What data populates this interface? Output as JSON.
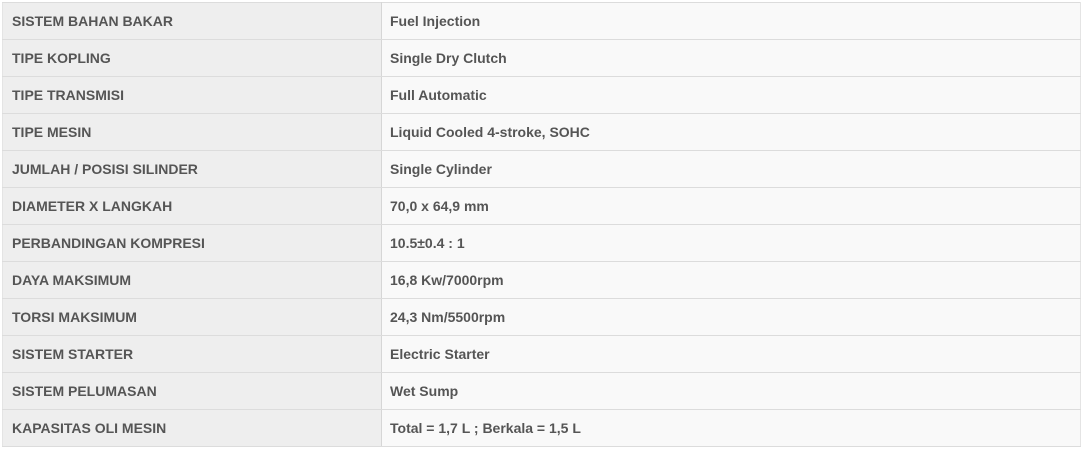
{
  "specs": [
    {
      "label": "SISTEM BAHAN BAKAR",
      "value": "Fuel Injection"
    },
    {
      "label": "TIPE KOPLING",
      "value": "Single Dry Clutch"
    },
    {
      "label": "TIPE TRANSMISI",
      "value": "Full Automatic"
    },
    {
      "label": "TIPE MESIN",
      "value": "Liquid Cooled 4-stroke, SOHC"
    },
    {
      "label": "JUMLAH / POSISI SILINDER",
      "value": "Single Cylinder"
    },
    {
      "label": "DIAMETER X LANGKAH",
      "value": "70,0 x 64,9 mm"
    },
    {
      "label": "PERBANDINGAN KOMPRESI",
      "value": "10.5±0.4 : 1"
    },
    {
      "label": "DAYA MAKSIMUM",
      "value": "16,8 Kw/7000rpm"
    },
    {
      "label": "TORSI MAKSIMUM",
      "value": "24,3 Nm/5500rpm"
    },
    {
      "label": "SISTEM STARTER",
      "value": "Electric Starter"
    },
    {
      "label": "SISTEM PELUMASAN",
      "value": "Wet Sump"
    },
    {
      "label": "KAPASITAS OLI MESIN",
      "value": "Total = 1,7 L ; Berkala = 1,5 L"
    }
  ],
  "colors": {
    "label_background": "#eeeeee",
    "value_background": "#f9f9f9",
    "text": "#555555",
    "border": "#dcdcdc"
  }
}
